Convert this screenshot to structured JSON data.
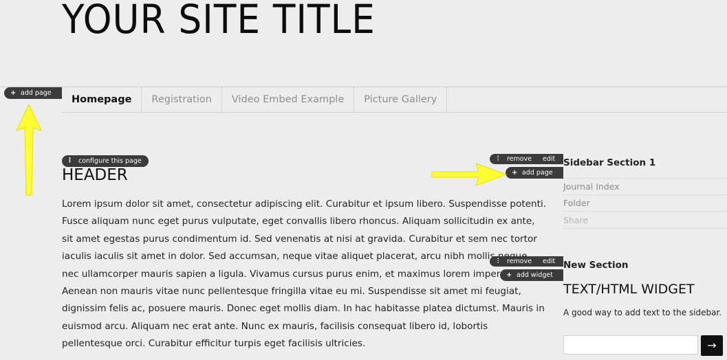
{
  "site": {
    "title": "YOUR SITE TITLE"
  },
  "controls": {
    "add_page_left": "add page",
    "configure_page": "configure this page",
    "remove": "remove",
    "edit": "edit",
    "add_page_right": "add page",
    "remove2": "remove",
    "edit2": "edit",
    "add_widget": "add widget"
  },
  "nav": {
    "items": [
      {
        "label": "Homepage",
        "active": true
      },
      {
        "label": "Registration"
      },
      {
        "label": "Video Embed Example"
      },
      {
        "label": "Picture Gallery"
      }
    ]
  },
  "main": {
    "heading": "HEADER",
    "body": "Lorem ipsum dolor sit amet, consectetur adipiscing elit. Curabitur et ipsum libero. Suspendisse potenti. Fusce aliquam nunc eget purus vulputate, eget convallis libero rhoncus. Aliquam sollicitudin ex ante, sit amet egestas purus condimentum id. Sed venenatis at nisi at gravida. Curabitur et sem nec tortor iaculis iaculis sit amet in dolor. Sed accumsan, neque vitae aliquet placerat, arcu nibh mollis neque, nec ullamcorper mauris sapien a ligula. Vivamus cursus purus enim, et maximus lorem imperdiet ac. Aenean non mauris vitae nunc pellentesque fringilla vitae eu mi. Suspendisse sit amet mi feugiat, dignissim felis ac, posuere mauris. Donec eget mollis diam. In hac habitasse platea dictumst. Mauris in euismod arcu. Aliquam nec erat ante. Nunc ex mauris, facilisis consequat libero id, lobortis pellentesque orci. Curabitur efficitur turpis eget facilisis ultricies."
  },
  "sidebar": {
    "section1_title": "Sidebar Section 1",
    "links": [
      "Journal Index",
      "Folder",
      "Share"
    ],
    "section2_title": "New Section",
    "widget_title": "TEXT/HTML WIDGET",
    "widget_text": "A good way to add text to the sidebar.",
    "search_button": "→"
  },
  "colors": {
    "arrow": "#ffff33",
    "pill": "#3b3b3b",
    "background": "#ededed"
  }
}
